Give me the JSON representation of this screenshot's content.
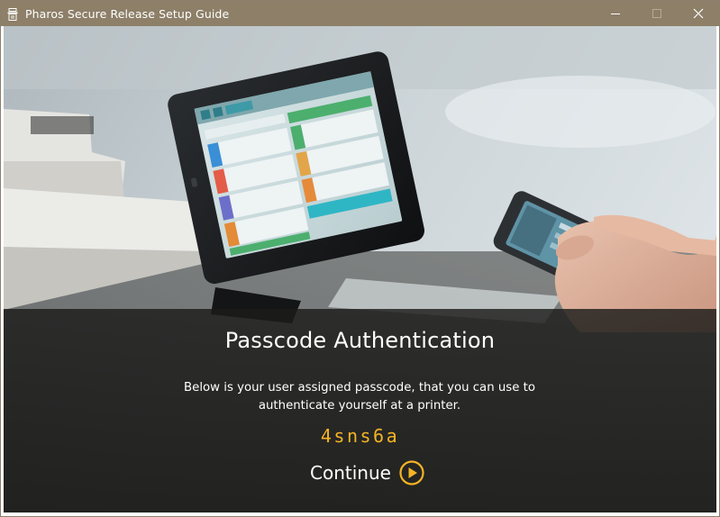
{
  "window": {
    "title": "Pharos Secure Release Setup Guide",
    "titlebar_color": "#8d7f68"
  },
  "icons": {
    "app": "printer-icon",
    "minimize": "minimize-icon",
    "maximize": "maximize-icon",
    "close": "close-icon",
    "continue": "play-circle-icon"
  },
  "hero": {
    "description": "Photo of a printer control panel tablet and a hand holding a smartphone"
  },
  "auth": {
    "heading": "Passcode Authentication",
    "description_line1": "Below is your user assigned passcode, that you can use to",
    "description_line2": "authenticate yourself at a printer.",
    "passcode": "4sns6a",
    "continue_label": "Continue",
    "accent_color": "#f5b324"
  }
}
